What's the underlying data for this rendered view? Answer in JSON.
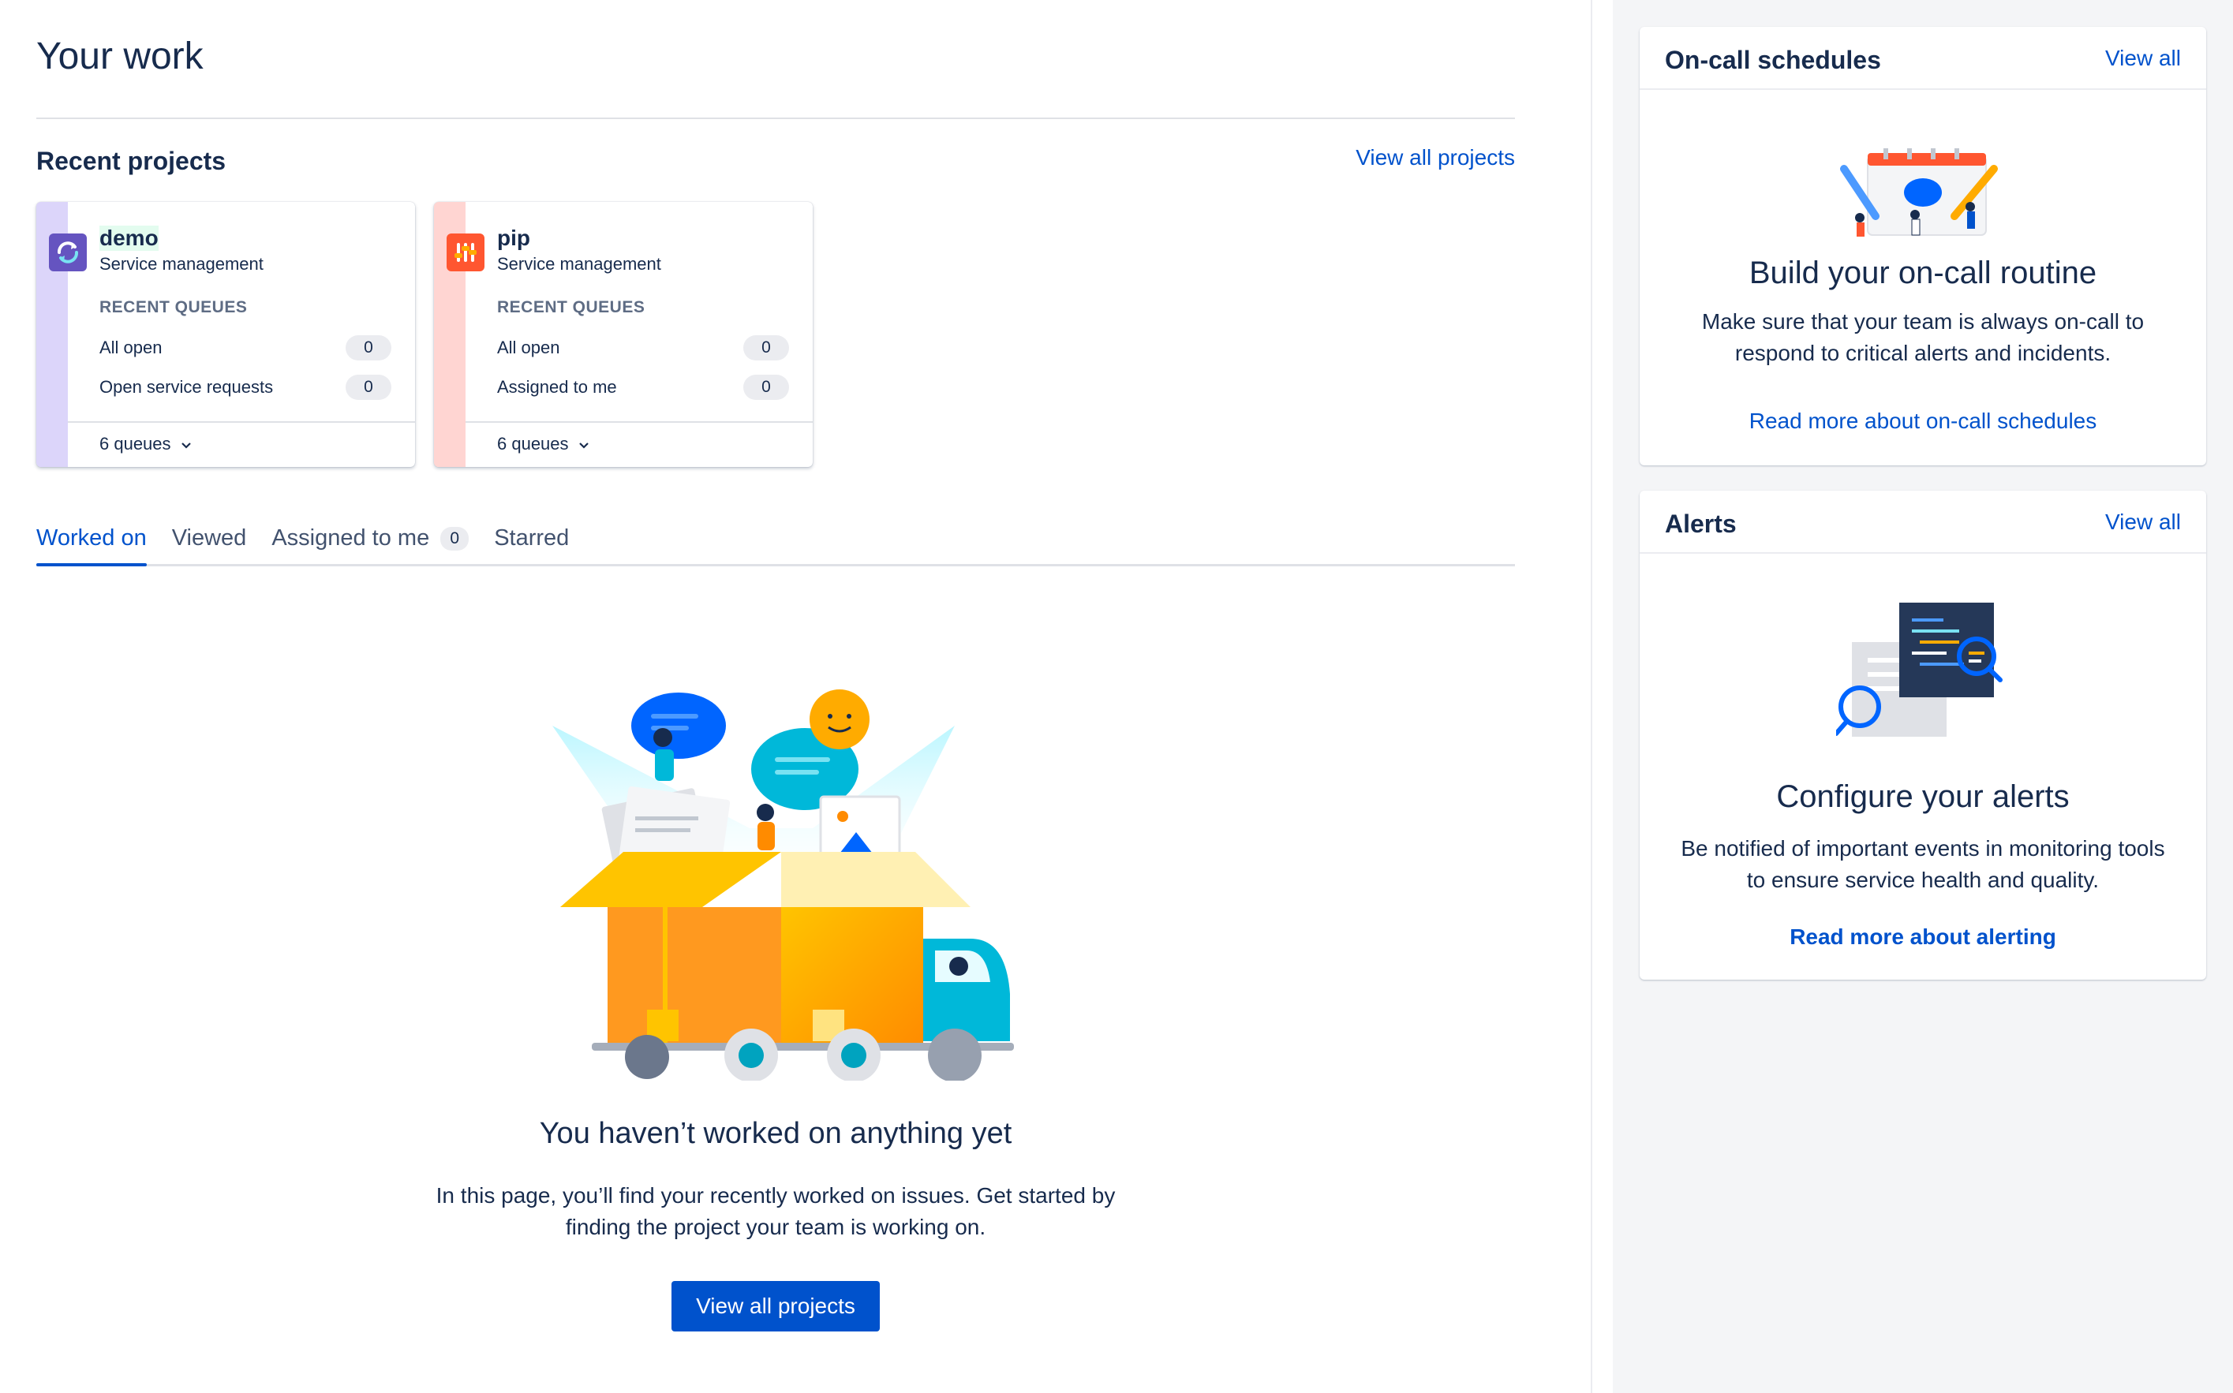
{
  "page": {
    "title": "Your work"
  },
  "recent_projects": {
    "title": "Recent projects",
    "view_all_label": "View all projects",
    "cards": [
      {
        "name": "demo",
        "type": "Service management",
        "section_label": "RECENT QUEUES",
        "queues": [
          {
            "label": "All open",
            "count": "0"
          },
          {
            "label": "Open service requests",
            "count": "0"
          }
        ],
        "footer_label": "6 queues",
        "stripe_color": "#dcd5fa",
        "avatar_color": "#6554c0"
      },
      {
        "name": "pip",
        "type": "Service management",
        "section_label": "RECENT QUEUES",
        "queues": [
          {
            "label": "All open",
            "count": "0"
          },
          {
            "label": "Assigned to me",
            "count": "0"
          }
        ],
        "footer_label": "6 queues",
        "stripe_color": "#ffd5d2",
        "avatar_color": "#ff5630"
      }
    ]
  },
  "tabs": [
    {
      "label": "Worked on",
      "active": true
    },
    {
      "label": "Viewed"
    },
    {
      "label": "Assigned to me",
      "count": "0"
    },
    {
      "label": "Starred"
    }
  ],
  "empty_state": {
    "title": "You haven’t worked on anything yet",
    "description": "In this page, you’ll find your recently worked on issues. Get started by finding the project your team is working on.",
    "button_label": "View all projects"
  },
  "oncall": {
    "title": "On-call schedules",
    "view_all_label": "View all",
    "heading": "Build your on-call routine",
    "description": "Make sure that your team is always on-call to respond to critical alerts and incidents.",
    "more_link": "Read more about on-call schedules"
  },
  "alerts": {
    "title": "Alerts",
    "view_all_label": "View all",
    "heading": "Configure your alerts",
    "description": "Be notified of important events in monitoring tools to ensure service health and quality.",
    "more_link": "Read more about alerting"
  },
  "colors": {
    "brand": "#0052cc",
    "text": "#172b4d",
    "subtle": "#5e6c84"
  }
}
